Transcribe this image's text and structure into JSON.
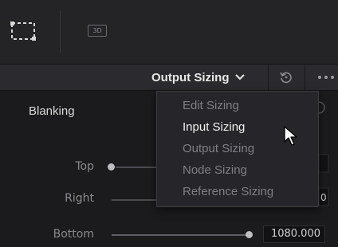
{
  "toolbar": {
    "transform_tool_icon": "transform-tool-icon",
    "badge_3d": "3D"
  },
  "header": {
    "dropdown_label": "Output Sizing",
    "chevron_icon": "chevron-down-icon",
    "reset_icon": "reset-icon",
    "more_icon": "more-options-icon"
  },
  "panel": {
    "section_label": "Blanking",
    "rows": [
      {
        "label": "Top",
        "value": ""
      },
      {
        "label": "Right",
        "value": ""
      },
      {
        "label": "Bottom",
        "value": "1080.000"
      }
    ]
  },
  "menu": {
    "items": [
      {
        "label": "Edit Sizing",
        "active": false
      },
      {
        "label": "Input Sizing",
        "active": true
      },
      {
        "label": "Output Sizing",
        "active": false
      },
      {
        "label": "Node Sizing",
        "active": false
      },
      {
        "label": "Reference Sizing",
        "active": false
      }
    ]
  },
  "colors": {
    "panel_bg": "#1b1b1d",
    "menu_bg": "#26262a",
    "active_text": "#f0f0f0",
    "inactive_text": "#7e7e84"
  }
}
